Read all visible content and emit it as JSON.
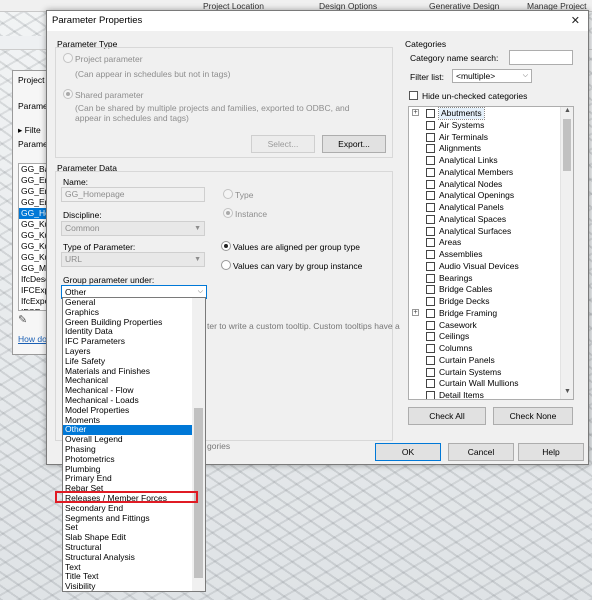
{
  "background": {
    "top_tabs": [
      "Project Location",
      "Design Options",
      "Generative Design",
      "Manage Project"
    ],
    "panel_title": "Project",
    "panel_labels": [
      "Paramete",
      "Filte",
      "Paramete"
    ],
    "param_items": [
      "GG_Bau",
      "GG_Ers",
      "GG_Ers",
      "GG_Ers",
      "GG_Ho",
      "GG_Kur",
      "GG_Kur",
      "GG_Kur",
      "GG_Kur",
      "GG_Mat",
      "IfcDesc",
      "IFCExpo",
      "IfcExpo",
      "IFCExpo"
    ],
    "selected_index": 4,
    "help_link": "How do"
  },
  "dialog": {
    "title": "Parameter Properties",
    "parameter_type": {
      "heading": "Parameter Type",
      "project_param": "Project parameter",
      "project_note": "(Can appear in schedules but not in tags)",
      "shared_param": "Shared parameter",
      "shared_note_1": "(Can be shared by multiple projects and families, exported to ODBC, and",
      "shared_note_2": "appear in schedules and tags)",
      "select_btn": "Select...",
      "export_btn": "Export..."
    },
    "parameter_data": {
      "heading": "Parameter Data",
      "name_label": "Name:",
      "name_value": "GG_Homepage",
      "type_radio": "Type",
      "instance_radio": "Instance",
      "discipline_label": "Discipline:",
      "discipline_value": "Common",
      "type_of_param_label": "Type of Parameter:",
      "type_of_param_value": "URL",
      "aligned_radio": "Values are aligned per group type",
      "vary_radio": "Values can vary by group instance",
      "group_label": "Group parameter under:",
      "group_value": "Other",
      "tooltip_partial": "ter to write a custom tooltip. Custom tooltips have a",
      "categories_partial": "gories"
    },
    "group_options": [
      "General",
      "Graphics",
      "Green Building Properties",
      "Identity Data",
      "IFC Parameters",
      "Layers",
      "Life Safety",
      "Materials and Finishes",
      "Mechanical",
      "Mechanical - Flow",
      "Mechanical - Loads",
      "Model Properties",
      "Moments",
      "Other",
      "Overall Legend",
      "Phasing",
      "Photometrics",
      "Plumbing",
      "Primary End",
      "Rebar Set",
      "Releases / Member Forces",
      "Secondary End",
      "Segments and Fittings",
      "Set",
      "Slab Shape Edit",
      "Structural",
      "Structural Analysis",
      "Text",
      "Title Text",
      "Visibility"
    ],
    "group_selected_index": 13,
    "group_highlight_index": 20,
    "categories": {
      "heading": "Categories",
      "search_label": "Category name search:",
      "search_value": "",
      "filter_label": "Filter list:",
      "filter_value": "<multiple>",
      "hide_unchecked": "Hide un-checked categories",
      "items": [
        "Abutments",
        "Air Systems",
        "Air Terminals",
        "Alignments",
        "Analytical Links",
        "Analytical Members",
        "Analytical Nodes",
        "Analytical Openings",
        "Analytical Panels",
        "Analytical Spaces",
        "Analytical Surfaces",
        "Areas",
        "Assemblies",
        "Audio Visual Devices",
        "Bearings",
        "Bridge Cables",
        "Bridge Decks",
        "Bridge Framing",
        "Casework",
        "Ceilings",
        "Columns",
        "Curtain Panels",
        "Curtain Systems",
        "Curtain Wall Mullions",
        "Detail Items"
      ],
      "expandable_indices": [
        0,
        17
      ],
      "check_all": "Check All",
      "check_none": "Check None"
    },
    "ok_btn": "OK",
    "cancel_btn": "Cancel",
    "help_btn": "Help"
  }
}
